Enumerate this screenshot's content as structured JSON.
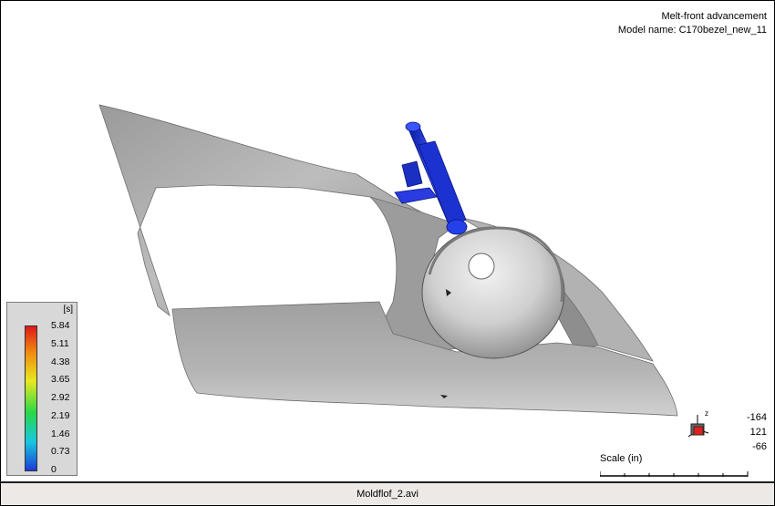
{
  "header": {
    "result_name": "Melt-front advancement",
    "model_name": "Model name: C170bezel_new_11"
  },
  "legend": {
    "unit": "[s]",
    "ticks": [
      "5.84",
      "5.11",
      "4.38",
      "3.65",
      "2.92",
      "2.19",
      "1.46",
      "0.73",
      "0"
    ]
  },
  "axis": {
    "z_label": "z"
  },
  "coords": {
    "x": "-164",
    "y": "121",
    "z": "-66"
  },
  "scale": {
    "label": "Scale (in)"
  },
  "status": {
    "filename": "Moldflof_2.avi"
  },
  "colors": {
    "part_gray": "#a9a9a9",
    "gate_blue": "#1f36c8",
    "gradient": [
      "#e01818",
      "#f08a10",
      "#e8e820",
      "#28d848",
      "#18c8e0",
      "#1c3cd8"
    ]
  }
}
